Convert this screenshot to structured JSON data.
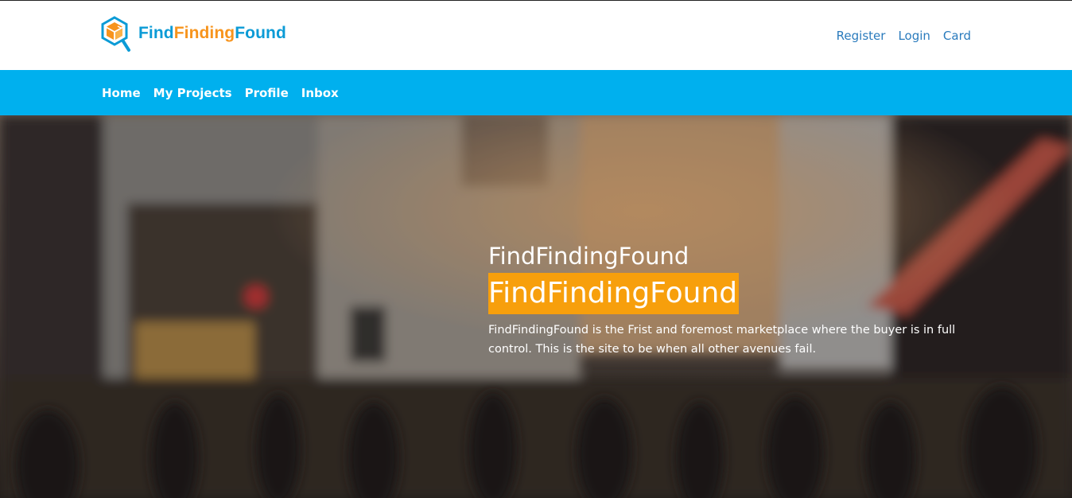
{
  "brand": {
    "logo_part1": "Find",
    "logo_part2": "Finding",
    "logo_part3": "Found",
    "icon": "hexagon-magnifier-logo-icon",
    "colors": {
      "blue": "#0b9bd6",
      "orange": "#f7941d"
    }
  },
  "top_links": {
    "register": "Register",
    "login": "Login",
    "card": "Card"
  },
  "nav": {
    "items": [
      {
        "label": "Home"
      },
      {
        "label": "My Projects"
      },
      {
        "label": "Profile"
      },
      {
        "label": "Inbox"
      }
    ],
    "background": "#00b0ee"
  },
  "hero": {
    "title": "FindFindingFound",
    "highlight": "FindFindingFound",
    "description": "FindFindingFound is the Frist and foremost marketplace where the buyer is in full control. This is the site to be when all other avenues fail.",
    "highlight_color": "#f79f0c",
    "background_image": "blurred-city-street-crowd"
  }
}
